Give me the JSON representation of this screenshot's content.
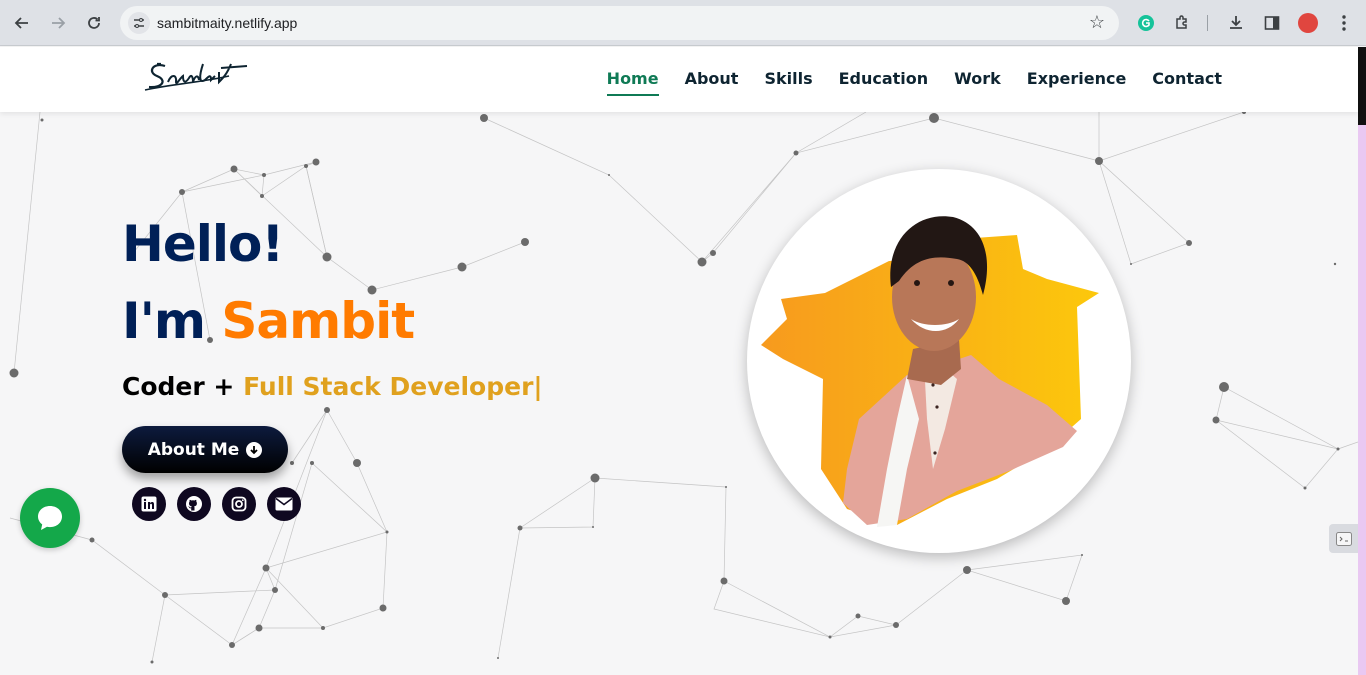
{
  "browser": {
    "url": "sambitmaity.netlify.app",
    "icons": [
      "back-icon",
      "forward-icon",
      "reload-icon",
      "site-settings-icon",
      "bookmark-star-icon",
      "grammarly-icon",
      "extensions-icon",
      "download-icon",
      "side-panel-icon",
      "profile-icon",
      "menu-icon"
    ]
  },
  "header": {
    "logo_text": "Sambit",
    "nav": [
      {
        "label": "Home",
        "active": true
      },
      {
        "label": "About"
      },
      {
        "label": "Skills"
      },
      {
        "label": "Education"
      },
      {
        "label": "Work"
      },
      {
        "label": "Experience"
      },
      {
        "label": "Contact"
      }
    ]
  },
  "hero": {
    "greeting": "Hello!",
    "intro_prefix": "I'm ",
    "name": "Sambit",
    "role_prefix": "Coder + ",
    "role_typed": "Full Stack Developer",
    "cursor": "|",
    "cta_label": "About Me",
    "socials": [
      "linkedin-icon",
      "github-icon",
      "instagram-icon",
      "email-icon"
    ]
  },
  "colors": {
    "navy": "#002057",
    "orange": "#ff7b00",
    "gold": "#e0a11e",
    "active_nav": "#0f7a55",
    "chat": "#14a84a"
  }
}
